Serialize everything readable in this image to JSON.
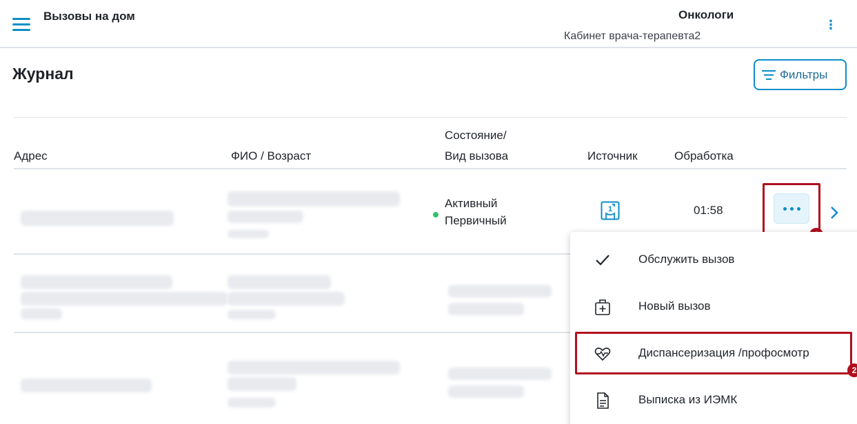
{
  "header": {
    "app_title": "Вызовы на дом",
    "org_name": "Онкологи",
    "cabinet": "Кабинет врача-терапевта2"
  },
  "page": {
    "title": "Журнал",
    "filters_label": "Фильтры"
  },
  "table": {
    "columns": {
      "address": "Адрес",
      "fio": "ФИО / Возраст",
      "state_line1": "Состояние/",
      "state_line2": "Вид вызова",
      "source": "Источник",
      "processing": "Обработка"
    },
    "rows": [
      {
        "status": "Активный",
        "type": "Первичный",
        "time": "01:58"
      }
    ]
  },
  "menu": {
    "items": [
      {
        "label": "Обслужить вызов",
        "icon": "check-icon"
      },
      {
        "label": "Новый вызов",
        "icon": "medical-bag-plus-icon"
      },
      {
        "label": "Диспансеризация /профосмотр",
        "icon": "heart-pulse-icon"
      },
      {
        "label": "Выписка из ИЭМК",
        "icon": "document-icon"
      }
    ]
  },
  "annotations": {
    "badge1": "1",
    "badge2": "2"
  },
  "colors": {
    "accent": "#0b8dc8",
    "highlight": "#b00e1e",
    "status_active": "#2ec36b"
  }
}
